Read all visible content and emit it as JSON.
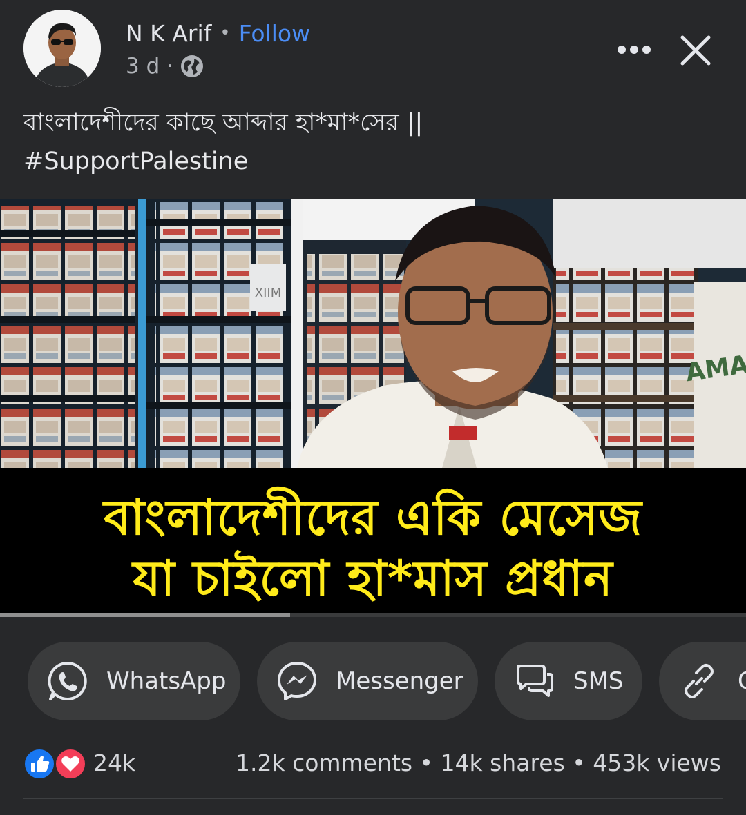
{
  "post": {
    "author": "N K Arif",
    "separator": "•",
    "follow_label": "Follow",
    "time": "3 d ·",
    "caption_line1": "বাংলাদেশীদের কাছে  আব্দার হা*মা*সের ||",
    "caption_line2": "#SupportPalestine"
  },
  "video": {
    "banner_line1": "বাংলাদেশীদের একি মেসেজ",
    "banner_line2": "যা চাইলো হা*মাস প্রধান",
    "shelf_labels": [
      "XIIM",
      "AMA"
    ]
  },
  "share": [
    {
      "label": "WhatsApp",
      "icon": "whatsapp-icon"
    },
    {
      "label": "Messenger",
      "icon": "messenger-icon"
    },
    {
      "label": "SMS",
      "icon": "sms-icon"
    },
    {
      "label": "C",
      "icon": "link-icon"
    }
  ],
  "stats": {
    "reactions": "24k",
    "engagement": "1.2k comments • 14k shares • 453k views"
  },
  "colors": {
    "background": "#27282a",
    "follow": "#4b8df5",
    "banner_text": "#ffeb1a",
    "button_bg": "#3a3b3c",
    "like": "#1877f2",
    "love": "#f33e58"
  }
}
